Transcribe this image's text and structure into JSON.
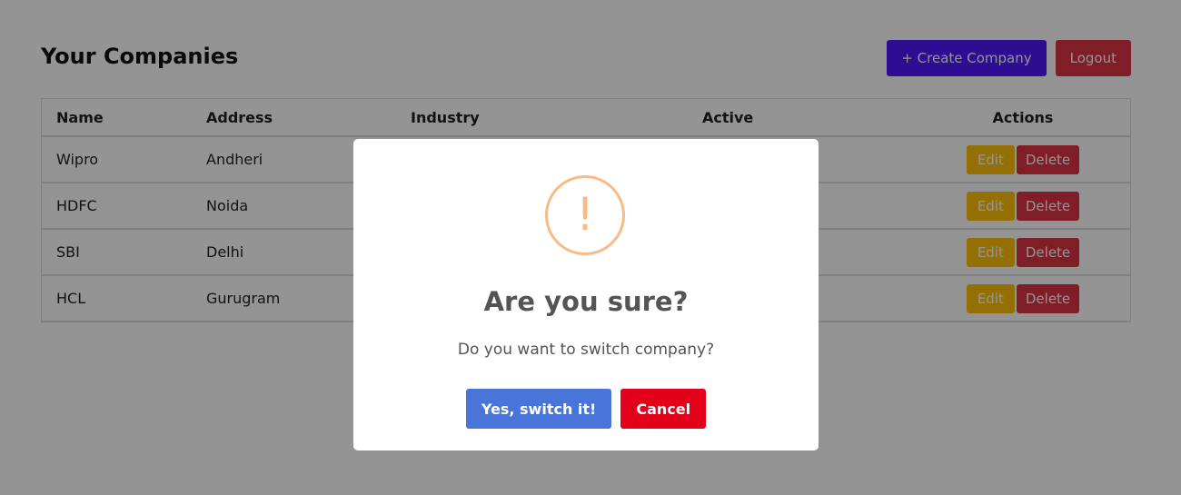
{
  "header": {
    "title": "Your Companies",
    "create_label": "+ Create Company",
    "logout_label": "Logout"
  },
  "table": {
    "columns": [
      "Name",
      "Address",
      "Industry",
      "Active",
      "Actions"
    ],
    "rows": [
      {
        "name": "Wipro",
        "address": "Andheri"
      },
      {
        "name": "HDFC",
        "address": "Noida"
      },
      {
        "name": "SBI",
        "address": "Delhi"
      },
      {
        "name": "HCL",
        "address": "Gurugram"
      }
    ],
    "edit_label": "Edit",
    "delete_label": "Delete"
  },
  "modal": {
    "icon": "warning-icon",
    "icon_glyph": "!",
    "title": "Are you sure?",
    "text": "Do you want to switch company?",
    "confirm_label": "Yes, switch it!",
    "cancel_label": "Cancel"
  },
  "colors": {
    "create_button": "#4e18fb",
    "danger": "#dc3545",
    "edit": "#ffc107",
    "confirm": "#4a75d8",
    "cancel": "#e3001b",
    "warning_icon": "#f8bb86"
  }
}
